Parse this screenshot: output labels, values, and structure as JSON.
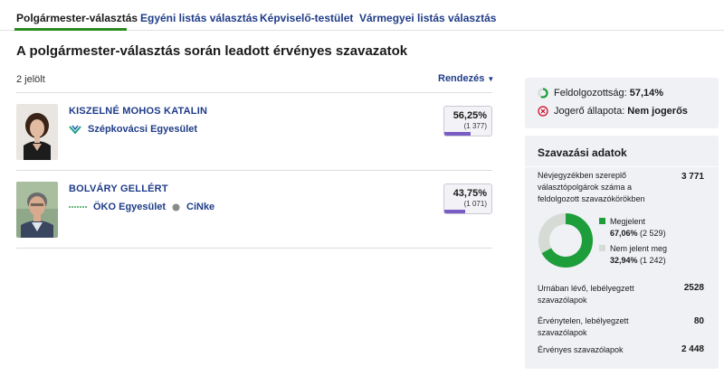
{
  "tabs": [
    {
      "label": "Polgármester-választás",
      "active": true
    },
    {
      "label": "Egyéni listás választás"
    },
    {
      "label": "Képviselő-testület"
    },
    {
      "label": "Vármegyei listás választás"
    }
  ],
  "main": {
    "title": "A polgármester-választás során leadott érvényes szavazatok",
    "count_label": "2 jelölt",
    "sort_label": "Rendezés"
  },
  "candidates": [
    {
      "name": "KISZELNÉ MOHOS KATALIN",
      "parties": [
        {
          "name": "Szépkovácsi Egyesület",
          "icon": "szepkovacsi-logo-icon"
        }
      ],
      "percent": "56,25%",
      "votes": "(1 377)",
      "share": 0.5625
    },
    {
      "name": "BOLVÁRY GELLÉRT",
      "parties": [
        {
          "name": "ÖKO Egyesület",
          "icon": "oko-logo-icon"
        },
        {
          "name": "CiNke",
          "icon": "cinke-logo-icon"
        }
      ],
      "percent": "43,75%",
      "votes": "(1 071)",
      "share": 0.4375
    }
  ],
  "status": {
    "processed_label": "Feldolgozottság:",
    "processed_value": "57,14%",
    "processed_share": 0.5714,
    "legal_label": "Jogerő állapota:",
    "legal_value": "Nem jogerős"
  },
  "stats": {
    "title": "Szavazási adatok",
    "registered_label": "Névjegyzékben szereplő választópolgárok száma a feldolgozott szavazókörökben",
    "registered_value": "3 771",
    "present_label": "Megjelent",
    "present_pct": "67,06%",
    "present_count": "(2 529)",
    "present_share": 0.6706,
    "absent_label": "Nem jelent meg",
    "absent_pct": "32,94%",
    "absent_count": "(1 242)",
    "urn_label": "Urnában lévő, lebélyegzett szavazólapok",
    "urn_value": "2528",
    "invalid_label": "Érvénytelen, lebélyegzett szavazólapok",
    "invalid_value": "80",
    "valid_label": "Érvényes szavazólapok",
    "valid_value": "2 448"
  },
  "colors": {
    "link": "#1f3c88",
    "accent_green": "#2a8a1f",
    "bar_purple": "#7a5cc4",
    "donut_present": "#1e9e3a",
    "donut_absent": "#d6dbd6",
    "error_red": "#d0021b"
  }
}
